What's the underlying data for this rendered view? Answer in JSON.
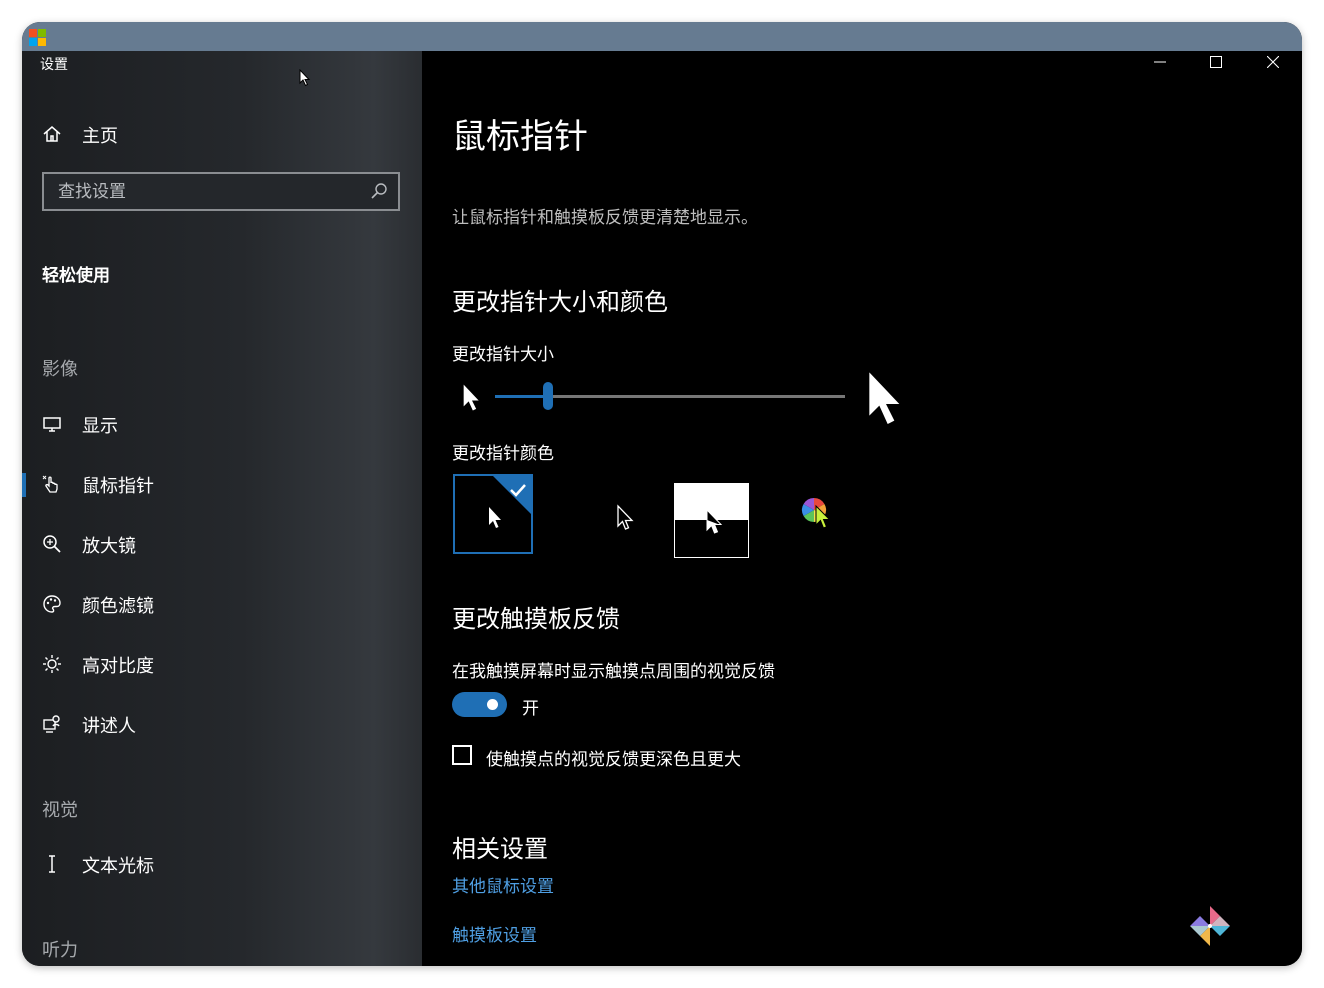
{
  "window": {
    "title": "设置"
  },
  "sidebar": {
    "home_label": "主页",
    "search_placeholder": "查找设置",
    "section_title": "轻松使用",
    "groups": {
      "vision": "影像",
      "visual": "视觉",
      "hearing": "听力"
    },
    "items": [
      {
        "label": "显示",
        "icon": "monitor-icon"
      },
      {
        "label": "鼠标指针",
        "icon": "pointer-hand-icon",
        "active": true
      },
      {
        "label": "放大镜",
        "icon": "magnifier-icon"
      },
      {
        "label": "颜色滤镜",
        "icon": "palette-icon"
      },
      {
        "label": "高对比度",
        "icon": "sun-icon"
      },
      {
        "label": "讲述人",
        "icon": "narrator-icon"
      },
      {
        "label": "文本光标",
        "icon": "text-cursor-icon"
      }
    ]
  },
  "content": {
    "title": "鼠标指针",
    "description": "让鼠标指针和触摸板反馈更清楚地显示。",
    "pointer_section": {
      "title": "更改指针大小和颜色",
      "size_label": "更改指针大小",
      "size_value": 0.15,
      "color_label": "更改指针颜色",
      "color_options": [
        "white",
        "black",
        "inverted",
        "custom"
      ],
      "selected_color": "white"
    },
    "touch_section": {
      "title": "更改触摸板反馈",
      "feedback_label": "在我触摸屏幕时显示触摸点周围的视觉反馈",
      "toggle_state": "开",
      "toggle_on": true,
      "checkbox_label": "使触摸点的视觉反馈更深色且更大",
      "checkbox_checked": false
    },
    "related": {
      "title": "相关设置",
      "links": [
        "其他鼠标设置",
        "触摸板设置"
      ]
    }
  },
  "colors": {
    "accent": "#1f6fb5",
    "link": "#4f9fe3",
    "titlebar": "#667b91",
    "custom_pointer": "#c8f03c"
  }
}
